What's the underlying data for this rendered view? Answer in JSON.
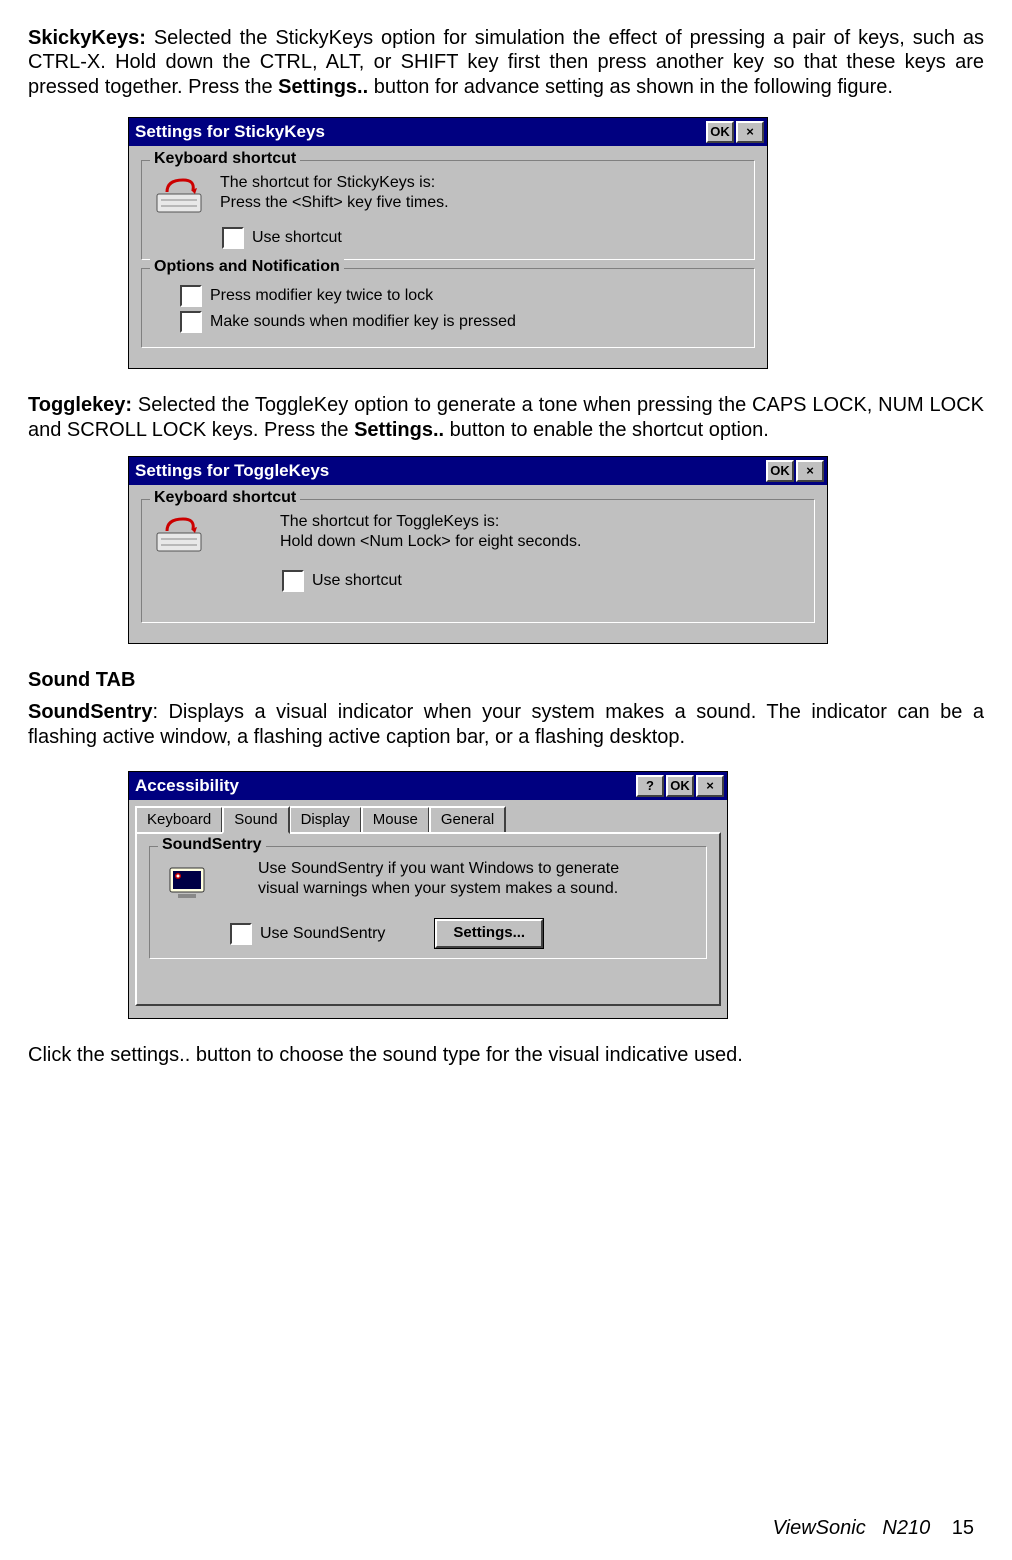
{
  "para1": {
    "lead": "SkickyKeys: ",
    "rest": "Selected the StickyKeys option for simulation the effect of pressing a pair of keys, such as CTRL-X. Hold down the CTRL, ALT, or SHIFT key first then press another key so that these keys are pressed together. Press the ",
    "bold2": "Settings..",
    "tail": " button for advance setting as shown in the following figure."
  },
  "dialog1": {
    "title": "Settings for StickyKeys",
    "ok": "OK",
    "close": "×",
    "group1_legend": "Keyboard shortcut",
    "shortcut_line1": "The shortcut for StickyKeys is:",
    "shortcut_line2": "Press the <Shift> key five times.",
    "use_shortcut": "Use shortcut",
    "group2_legend": "Options and Notification",
    "opt1": "Press modifier key twice to lock",
    "opt2": "Make sounds when modifier key is pressed"
  },
  "para2": {
    "lead": "Togglekey: ",
    "rest": "Selected the ToggleKey option to generate a tone when pressing the CAPS LOCK, NUM LOCK and SCROLL LOCK keys. Press the ",
    "bold2": "Settings..",
    "tail": " button to enable the shortcut option."
  },
  "dialog2": {
    "title": "Settings for ToggleKeys",
    "ok": "OK",
    "close": "×",
    "group1_legend": "Keyboard shortcut",
    "shortcut_line1": "The shortcut for ToggleKeys is:",
    "shortcut_line2": "Hold down <Num Lock> for eight seconds.",
    "use_shortcut": "Use shortcut"
  },
  "heading_sound": "Sound TAB",
  "para3": {
    "lead": "SoundSentry",
    "rest": ": Displays a visual indicator when your system makes a sound. The indicator can be a flashing active window, a flashing active caption bar, or a flashing desktop."
  },
  "dialog3": {
    "title": "Accessibility",
    "help": "?",
    "ok": "OK",
    "close": "×",
    "tabs": {
      "t1": "Keyboard",
      "t2": "Sound",
      "t3": "Display",
      "t4": "Mouse",
      "t5": "General"
    },
    "group_legend": "SoundSentry",
    "desc1": "Use SoundSentry if you want Windows to generate",
    "desc2": "visual warnings when your system makes a sound.",
    "use_ss": "Use SoundSentry",
    "settings_btn": "Settings..."
  },
  "para4": "Click the settings.. button to choose the sound type for the visual indicative used.",
  "footer": {
    "brand": "ViewSonic",
    "model": "N210",
    "page": "15"
  }
}
